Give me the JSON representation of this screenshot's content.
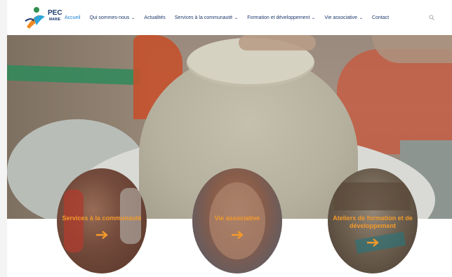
{
  "logo": {
    "text": "PEC",
    "subtext": "MARIE"
  },
  "nav": {
    "items": [
      {
        "label": "Accueil",
        "active": true,
        "dropdown": false
      },
      {
        "label": "Qui sommes-nous",
        "active": false,
        "dropdown": true
      },
      {
        "label": "Actualités",
        "active": false,
        "dropdown": false
      },
      {
        "label": "Services à la communauté",
        "active": false,
        "dropdown": true
      },
      {
        "label": "Formation et développement",
        "active": false,
        "dropdown": true
      },
      {
        "label": "Vie associative",
        "active": false,
        "dropdown": true
      },
      {
        "label": "Contact",
        "active": false,
        "dropdown": false
      }
    ],
    "search_icon": "search-icon"
  },
  "cards": [
    {
      "label": "Services à la communauté",
      "icon": "arrow-right-icon"
    },
    {
      "label": "Vie associative",
      "icon": "arrow-right-icon"
    },
    {
      "label": "Ateliers de formation et de développement",
      "icon": "arrow-right-icon"
    }
  ],
  "colors": {
    "accent_nav": "#1a7fd0",
    "nav_text": "#1d3a6e",
    "card_label": "#f39a2a"
  }
}
